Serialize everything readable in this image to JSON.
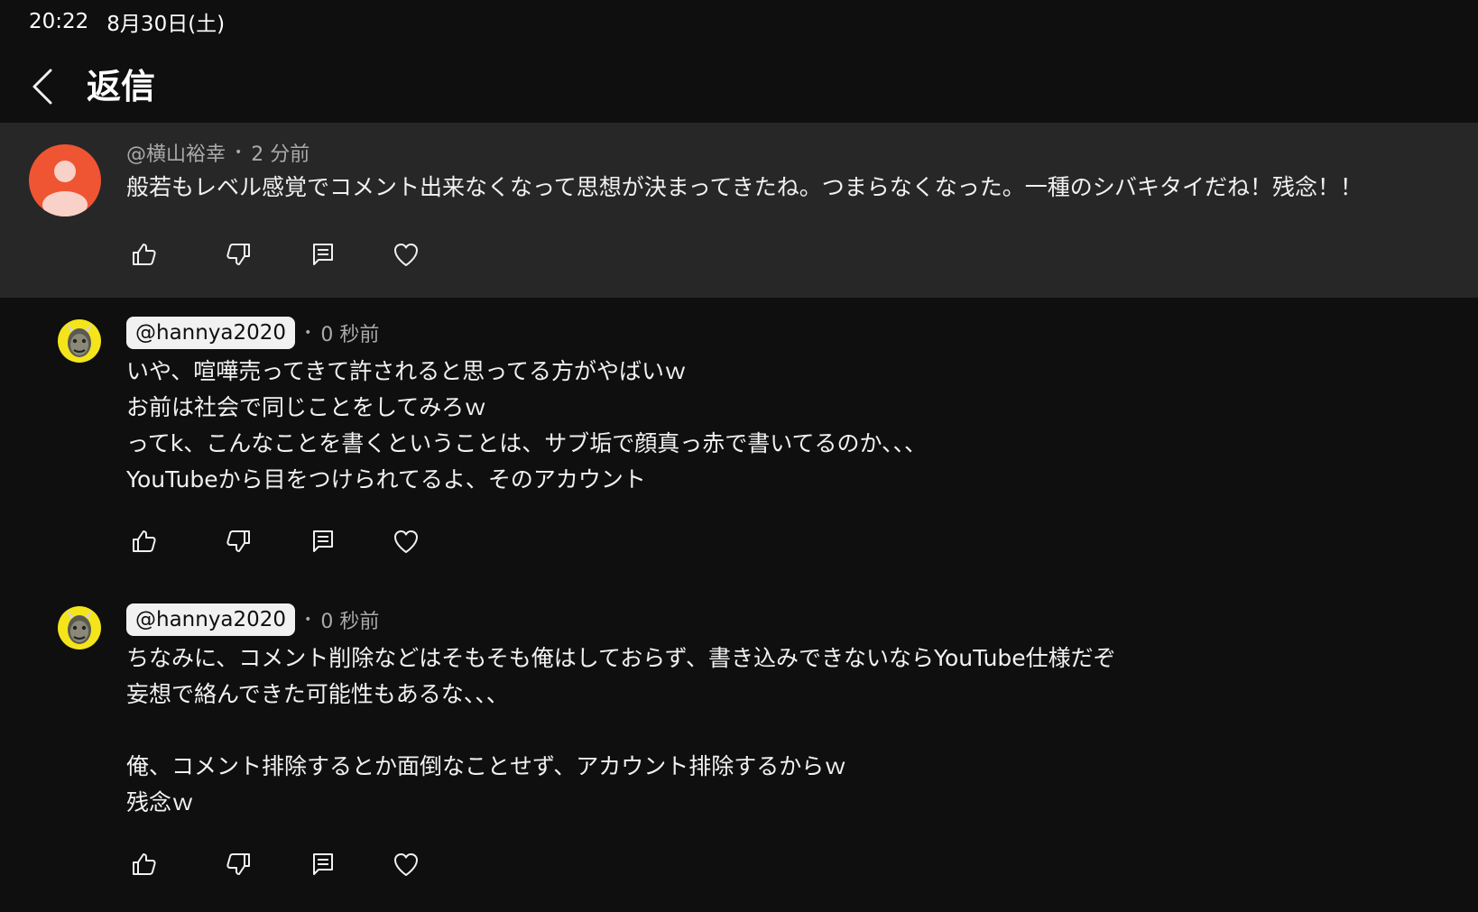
{
  "status_bar": {
    "time": "20:22",
    "date": "8月30日(土)"
  },
  "header": {
    "title": "返信"
  },
  "parent_comment": {
    "author": "@横山裕幸",
    "time": "2 分前",
    "text": "般若もレベル感覚でコメント出来なくなって思想が決まってきたね。つまらなくなった。一種のシバキタイだね！残念！！"
  },
  "replies": [
    {
      "author": "@hannya2020",
      "time": "0 秒前",
      "text": "いや、喧嘩売ってきて許されると思ってる方がやばいｗ\nお前は社会で同じことをしてみろｗ\nってk、こんなことを書くということは、サブ垢で顔真っ赤で書いてるのか、、、\nYouTubeから目をつけられてるよ、そのアカウント"
    },
    {
      "author": "@hannya2020",
      "time": "0 秒前",
      "text": "ちなみに、コメント削除などはそもそも俺はしておらず、書き込みできないならYouTube仕様だぞ\n妄想で絡んできた可能性もあるな、、、\n\n俺、コメント排除するとか面倒なことせず、アカウント排除するからｗ\n残念ｗ"
    }
  ],
  "icons": {
    "like": "thumbs-up-icon",
    "dislike": "thumbs-down-icon",
    "reply": "comment-icon",
    "heart": "heart-icon",
    "back": "chevron-left-icon"
  },
  "colors": {
    "background": "#0f0f0f",
    "parent_background": "#272727",
    "default_avatar": "#ef5533",
    "oni_avatar_bg": "#f3e51a",
    "text_primary": "#f1f1f1",
    "text_secondary": "#aaaaaa"
  }
}
